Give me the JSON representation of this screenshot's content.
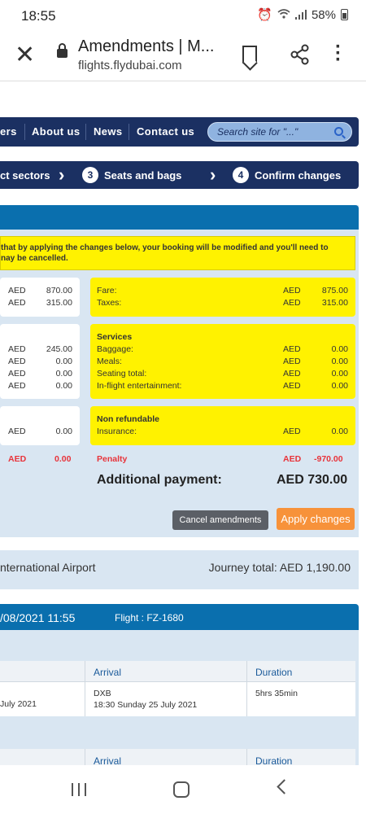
{
  "status": {
    "time": "18:55",
    "battery": "58%"
  },
  "browser": {
    "title": "Amendments | M...",
    "url": "flights.flydubai.com"
  },
  "nav": {
    "items": [
      "ers",
      "About us",
      "News",
      "Contact us"
    ],
    "search_placeholder": "Search site for \"...\""
  },
  "steps": {
    "s1_label": "ct sectors",
    "s3_num": "3",
    "s3_label": "Seats and bags",
    "s4_num": "4",
    "s4_label": "Confirm changes"
  },
  "notice": {
    "line1": "that by applying the changes below, your booking will be modified and you'll need to",
    "line2": "nay be cancelled."
  },
  "old": {
    "fare": {
      "cur": "AED",
      "val": "870.00"
    },
    "taxes": {
      "cur": "AED",
      "val": "315.00"
    },
    "services": [
      {
        "cur": "AED",
        "val": "245.00"
      },
      {
        "cur": "AED",
        "val": "0.00"
      },
      {
        "cur": "AED",
        "val": "0.00"
      },
      {
        "cur": "AED",
        "val": "0.00"
      }
    ],
    "insurance": {
      "cur": "AED",
      "val": "0.00"
    },
    "penalty": {
      "cur": "AED",
      "val": "0.00"
    }
  },
  "new": {
    "fare_label": "Fare:",
    "fare_cur": "AED",
    "fare_val": "875.00",
    "taxes_label": "Taxes:",
    "taxes_cur": "AED",
    "taxes_val": "315.00",
    "services_title": "Services",
    "services": [
      {
        "label": "Baggage:",
        "cur": "AED",
        "val": "0.00"
      },
      {
        "label": "Meals:",
        "cur": "AED",
        "val": "0.00"
      },
      {
        "label": "Seating total:",
        "cur": "AED",
        "val": "0.00"
      },
      {
        "label": "In-flight entertainment:",
        "cur": "AED",
        "val": "0.00"
      }
    ],
    "nonref_title": "Non refundable",
    "insurance_label": "Insurance:",
    "insurance_cur": "AED",
    "insurance_val": "0.00",
    "penalty_label": "Penalty",
    "penalty_cur": "AED",
    "penalty_val": "-970.00"
  },
  "additional": {
    "label": "Additional payment:",
    "amount": "AED 730.00"
  },
  "buttons": {
    "cancel": "Cancel amendments",
    "apply": "Apply changes"
  },
  "journey": {
    "airport": "nternational Airport",
    "total": "Journey total: AED 1,190.00"
  },
  "flight": {
    "datetime": "/08/2021 11:55",
    "flight_no": "Flight : FZ-1680",
    "columns": {
      "arrival": "Arrival",
      "duration": "Duration"
    },
    "row": {
      "dep_date": "July 2021",
      "arr_code": "DXB",
      "arr_time": "18:30 Sunday 25 July 2021",
      "duration": "5hrs 35min"
    }
  }
}
